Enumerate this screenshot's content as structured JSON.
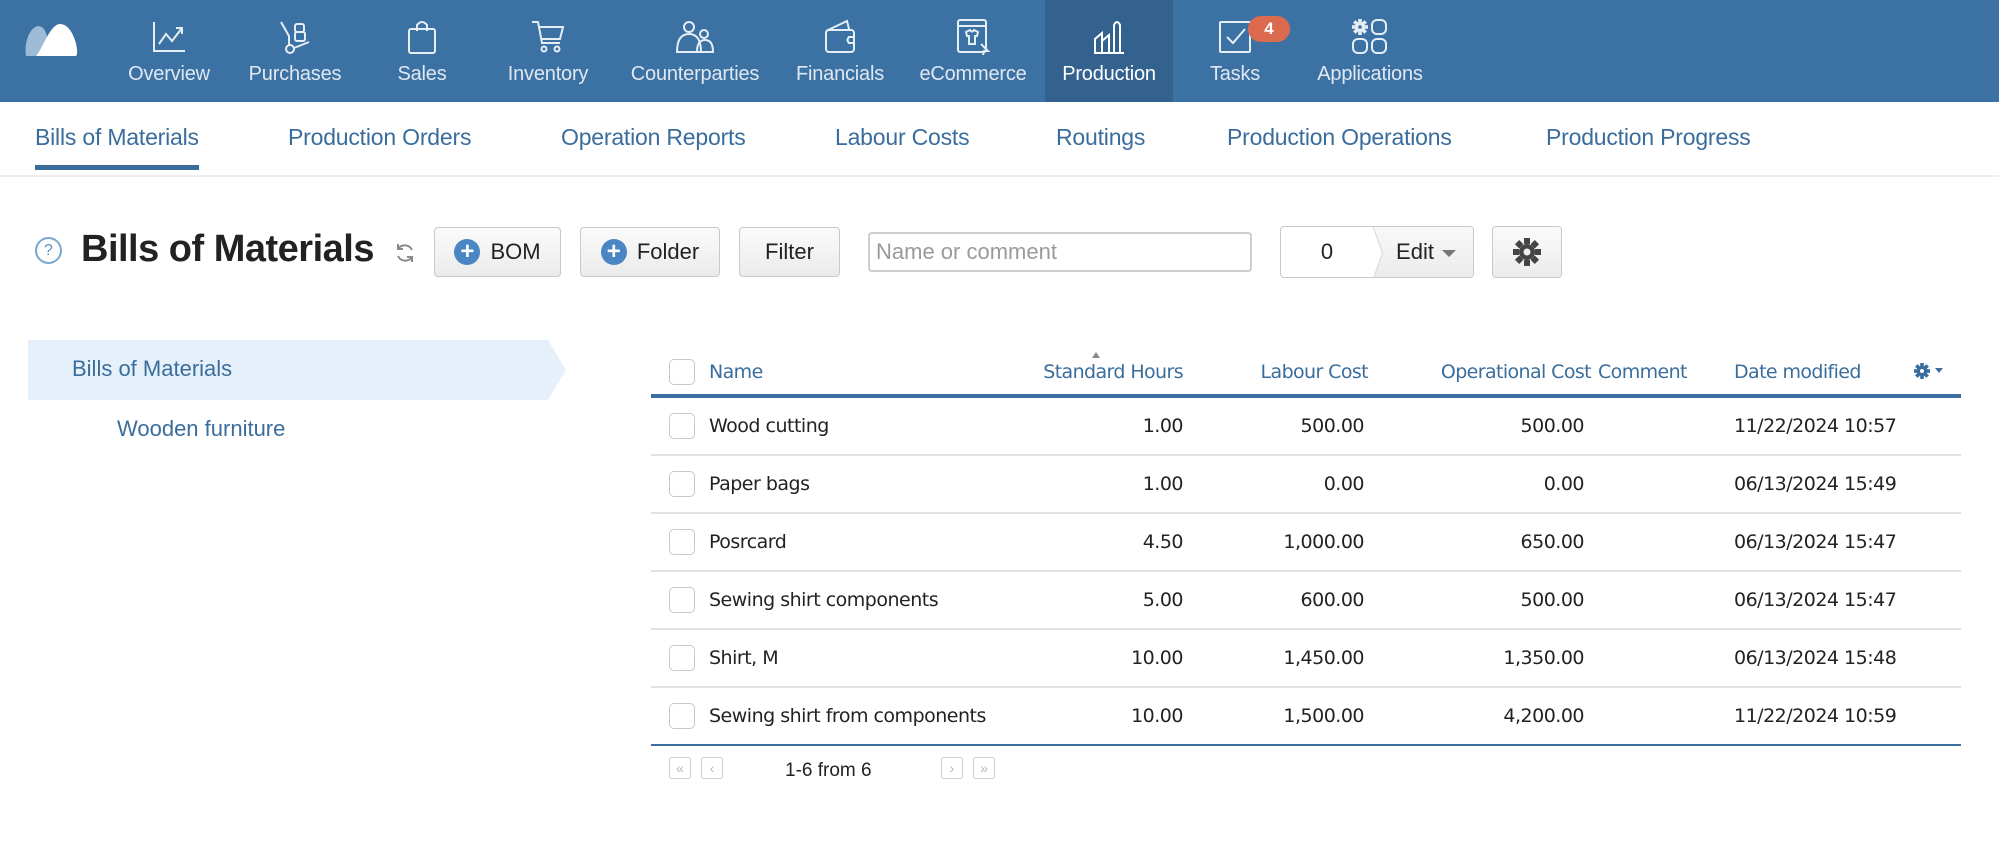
{
  "topnav": {
    "items": [
      {
        "label": "Overview",
        "icon": "chart-line-icon"
      },
      {
        "label": "Purchases",
        "icon": "hand-truck-icon"
      },
      {
        "label": "Sales",
        "icon": "shopping-bag-icon"
      },
      {
        "label": "Inventory",
        "icon": "cart-icon"
      },
      {
        "label": "Counterparties",
        "icon": "people-icon"
      },
      {
        "label": "Financials",
        "icon": "wallet-icon"
      },
      {
        "label": "eCommerce",
        "icon": "storefront-icon"
      },
      {
        "label": "Production",
        "icon": "factory-icon",
        "active": true
      },
      {
        "label": "Tasks",
        "icon": "checkbox-icon",
        "badge": "4"
      },
      {
        "label": "Applications",
        "icon": "apps-grid-icon"
      }
    ],
    "colors": {
      "bar": "#3c71a3",
      "active": "#33628f",
      "badge": "#dc6a4f"
    }
  },
  "subnav": {
    "tabs": [
      {
        "label": "Bills of Materials",
        "active": true
      },
      {
        "label": "Production Orders"
      },
      {
        "label": "Operation Reports"
      },
      {
        "label": "Labour Costs"
      },
      {
        "label": "Routings"
      },
      {
        "label": "Production Operations"
      },
      {
        "label": "Production Progress"
      }
    ]
  },
  "toolbar": {
    "help": "?",
    "title": "Bills of Materials",
    "bom_label": "BOM",
    "folder_label": "Folder",
    "filter_label": "Filter",
    "search_placeholder": "Name or comment",
    "search_value": "",
    "selected_count": "0",
    "edit_label": "Edit"
  },
  "tree": {
    "root": "Bills of Materials",
    "children": [
      "Wooden furniture"
    ]
  },
  "table": {
    "columns": {
      "name": "Name",
      "standard_hours": "Standard Hours",
      "labour_cost": "Labour Cost",
      "operational_cost": "Operational Cost",
      "comment": "Comment",
      "date_modified": "Date modified"
    },
    "rows": [
      {
        "name": "Wood cutting",
        "standard_hours": "1.00",
        "labour_cost": "500.00",
        "operational_cost": "500.00",
        "comment": "",
        "date_modified": "11/22/2024 10:57"
      },
      {
        "name": "Paper bags",
        "standard_hours": "1.00",
        "labour_cost": "0.00",
        "operational_cost": "0.00",
        "comment": "",
        "date_modified": "06/13/2024 15:49"
      },
      {
        "name": "Posrcard",
        "standard_hours": "4.50",
        "labour_cost": "1,000.00",
        "operational_cost": "650.00",
        "comment": "",
        "date_modified": "06/13/2024 15:47"
      },
      {
        "name": "Sewing shirt components",
        "standard_hours": "5.00",
        "labour_cost": "600.00",
        "operational_cost": "500.00",
        "comment": "",
        "date_modified": "06/13/2024 15:47"
      },
      {
        "name": "Shirt, M",
        "standard_hours": "10.00",
        "labour_cost": "1,450.00",
        "operational_cost": "1,350.00",
        "comment": "",
        "date_modified": "06/13/2024 15:48"
      },
      {
        "name": "Sewing shirt from components",
        "standard_hours": "10.00",
        "labour_cost": "1,500.00",
        "operational_cost": "4,200.00",
        "comment": "",
        "date_modified": "11/22/2024 10:59"
      }
    ]
  },
  "pager": {
    "first": "«",
    "prev": "‹",
    "next": "›",
    "last": "»",
    "summary": "1-6 from 6"
  }
}
